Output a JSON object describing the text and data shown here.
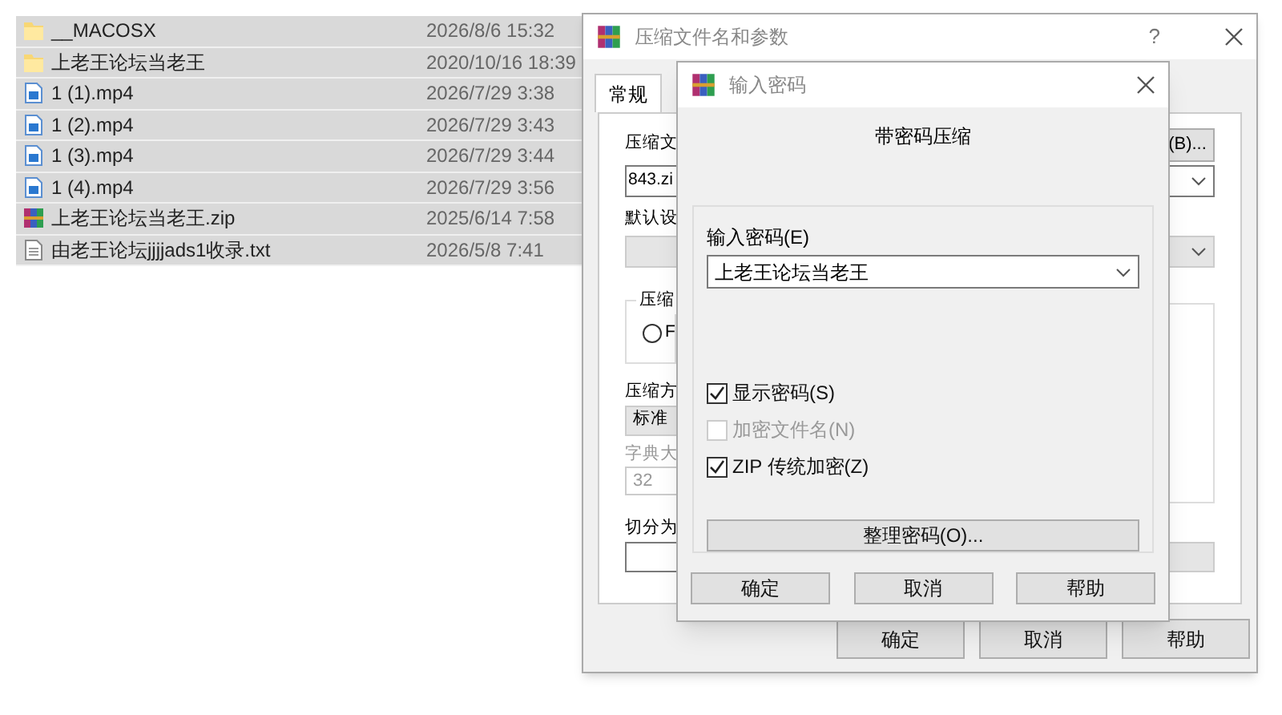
{
  "file_list": {
    "rows": [
      {
        "kind": "folder",
        "name": "__MACOSX",
        "date": "2026/8/6 15:32",
        "selected": true
      },
      {
        "kind": "folder",
        "name": "上老王论坛当老王",
        "date": "2020/10/16 18:39",
        "selected": true
      },
      {
        "kind": "video",
        "name": "1 (1).mp4",
        "date": "2026/7/29 3:38",
        "selected": true
      },
      {
        "kind": "video",
        "name": "1 (2).mp4",
        "date": "2026/7/29 3:43",
        "selected": true
      },
      {
        "kind": "video",
        "name": "1 (3).mp4",
        "date": "2026/7/29 3:44",
        "selected": true
      },
      {
        "kind": "video",
        "name": "1 (4).mp4",
        "date": "2026/7/29 3:56",
        "selected": true
      },
      {
        "kind": "archive",
        "name": "上老王论坛当老王.zip",
        "date": "2025/6/14 7:58",
        "selected": true
      },
      {
        "kind": "text",
        "name": "由老王论坛jjjjads1收录.txt",
        "date": "2026/5/8 7:41",
        "selected": true
      }
    ]
  },
  "archive_dialog": {
    "title": "压缩文件名和参数",
    "help": "?",
    "tabs": [
      {
        "label": "常规",
        "selected": true
      }
    ],
    "archive_name_label": "压缩文",
    "browse_button": "(B)...",
    "archive_name": "843.zi",
    "profile_label": "默认设",
    "format_group_label": "压缩",
    "format_option": "F",
    "format_option_selected": false,
    "method_label": "压缩方",
    "method": "标准",
    "dictionary_label": "字典大",
    "dictionary": "32",
    "split_label": "切分为",
    "buttons": [
      "确定",
      "取消",
      "帮助"
    ]
  },
  "password_dialog": {
    "title": "输入密码",
    "heading": "带密码压缩",
    "password_label": "输入密码(E)",
    "password": "上老王论坛当老王",
    "options": [
      {
        "label": "显示密码(S)",
        "checked": true,
        "disabled": false
      },
      {
        "label": "加密文件名(N)",
        "checked": false,
        "disabled": true
      },
      {
        "label": "ZIP 传统加密(Z)",
        "checked": true,
        "disabled": false
      }
    ],
    "manage_button": "整理密码(O)...",
    "buttons": [
      "确定",
      "取消",
      "帮助"
    ]
  }
}
